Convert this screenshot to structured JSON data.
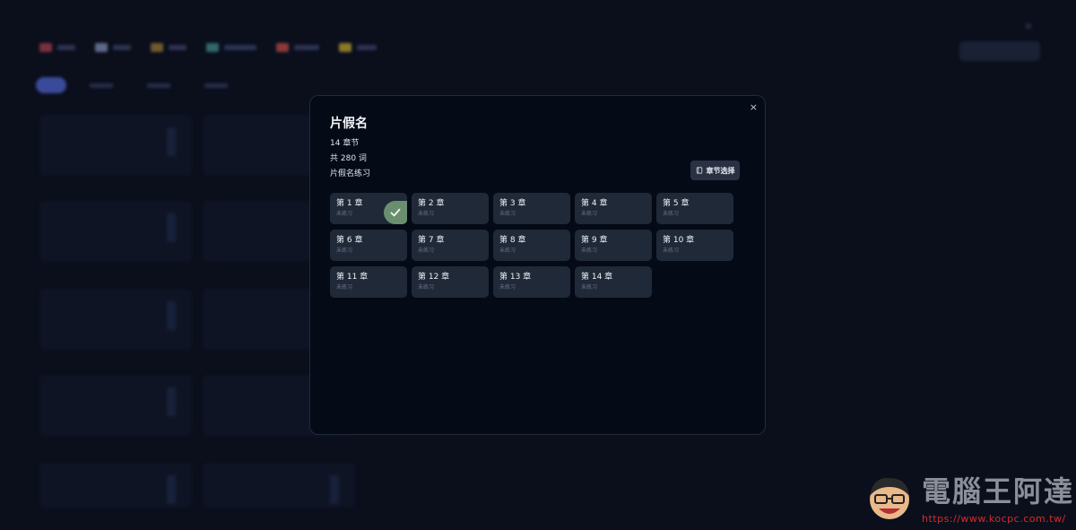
{
  "modal": {
    "title": "片假名",
    "chapter_count": "14 章节",
    "word_count": "共 280 词",
    "description": "片假名练习",
    "chapter_select_label": "章节选择",
    "close_symbol": "×",
    "chapters": [
      {
        "name": "第 1 章",
        "status": "未练习",
        "completed": true
      },
      {
        "name": "第 2 章",
        "status": "未练习",
        "completed": false
      },
      {
        "name": "第 3 章",
        "status": "未练习",
        "completed": false
      },
      {
        "name": "第 4 章",
        "status": "未练习",
        "completed": false
      },
      {
        "name": "第 5 章",
        "status": "未练习",
        "completed": false
      },
      {
        "name": "第 6 章",
        "status": "未练习",
        "completed": false
      },
      {
        "name": "第 7 章",
        "status": "未练习",
        "completed": false
      },
      {
        "name": "第 8 章",
        "status": "未练习",
        "completed": false
      },
      {
        "name": "第 9 章",
        "status": "未练习",
        "completed": false
      },
      {
        "name": "第 10 章",
        "status": "未练习",
        "completed": false
      },
      {
        "name": "第 11 章",
        "status": "未练习",
        "completed": false
      },
      {
        "name": "第 12 章",
        "status": "未练习",
        "completed": false
      },
      {
        "name": "第 13 章",
        "status": "未练习",
        "completed": false
      },
      {
        "name": "第 14 章",
        "status": "未练习",
        "completed": false
      }
    ]
  },
  "watermark": {
    "brand": "電腦王阿達",
    "url": "https://www.kocpc.com.tw/"
  },
  "colors": {
    "page_bg": "#0b0f1c",
    "modal_bg": "#050a17",
    "chapter_bg": "#202938",
    "check_badge": "#6a8f6e",
    "button_bg": "#2a3142",
    "watermark_url": "#d62b2b"
  }
}
